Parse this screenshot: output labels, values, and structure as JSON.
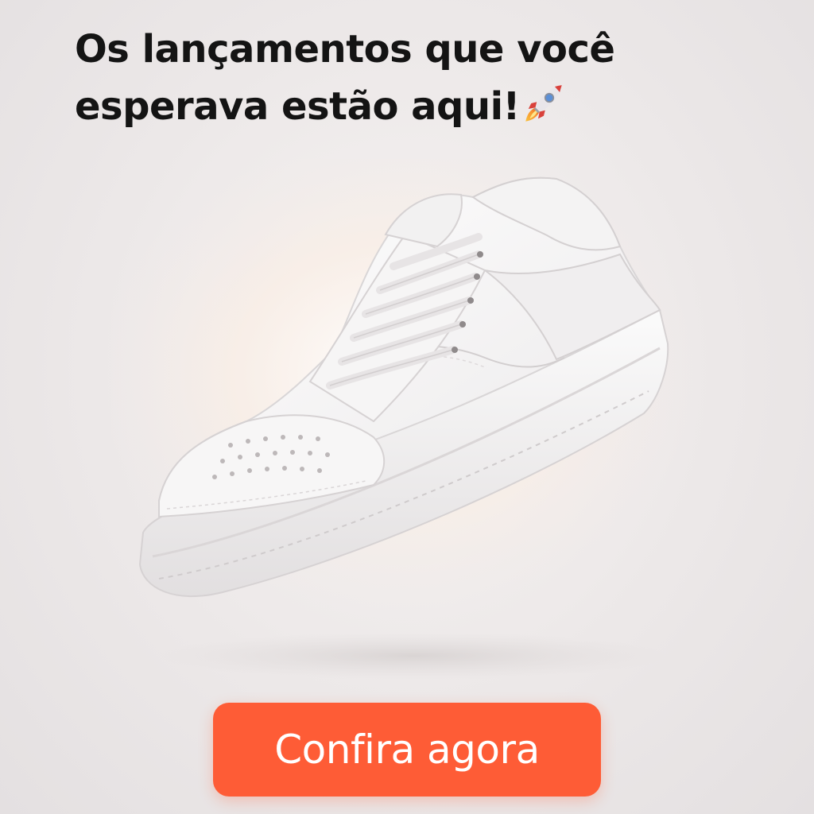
{
  "headline": {
    "line1": "Os lançamentos que você",
    "line2": "esperava estão aqui!",
    "emoji_icon": "rocket-icon"
  },
  "hero": {
    "image": "white-sneaker"
  },
  "cta": {
    "label": "Confira agora",
    "color": "#fe5c36"
  },
  "colors": {
    "background": "#ece8e8",
    "text": "#141414",
    "button_text": "#ffffff"
  }
}
